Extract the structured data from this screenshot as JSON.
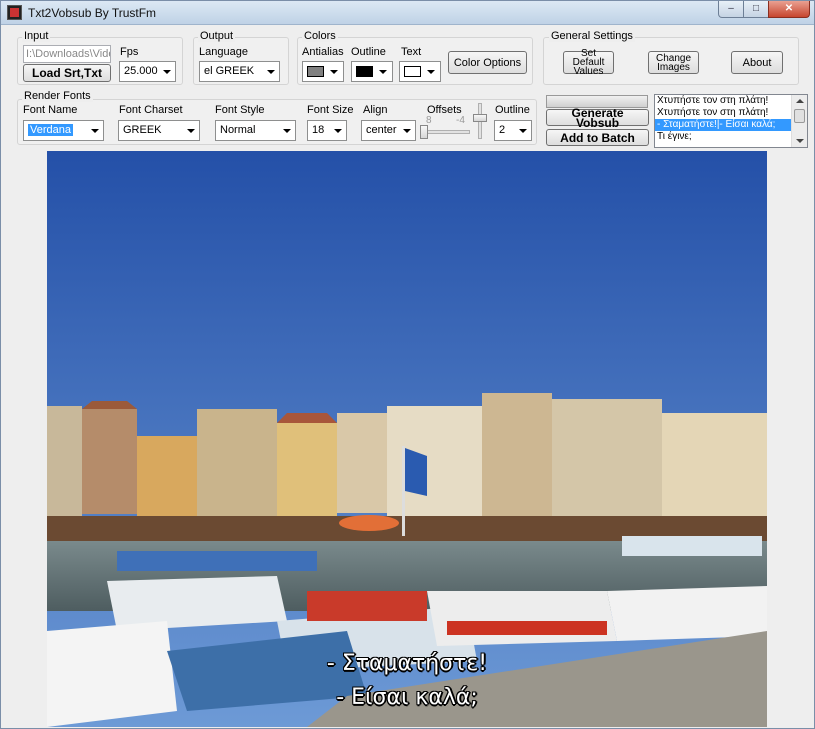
{
  "window": {
    "title": "Txt2Vobsub By TrustFm",
    "controls": {
      "minimize": "–",
      "maximize": "□",
      "close": "✕"
    }
  },
  "input": {
    "group_label": "Input",
    "path_value": "I:\\Downloads\\Video",
    "load_button": "Load Srt,Txt",
    "fps_label": "Fps",
    "fps_value": "25.000"
  },
  "output": {
    "group_label": "Output",
    "language_label": "Language",
    "language_value": "el GREEK"
  },
  "colors": {
    "group_label": "Colors",
    "antialias_label": "Antialias",
    "outline_label": "Outline",
    "text_label": "Text",
    "antialias_color": "#808080",
    "outline_color": "#000000",
    "text_color": "#ffffff",
    "options_button": "Color Options"
  },
  "general": {
    "group_label": "General Settings",
    "set_default_button": "Set Default Values",
    "change_images_button": "Change Images",
    "about_button": "About"
  },
  "render": {
    "group_label": "Render Fonts",
    "font_name_label": "Font Name",
    "font_name_value": "Verdana",
    "charset_label": "Font Charset",
    "charset_value": "GREEK",
    "style_label": "Font Style",
    "style_value": "Normal",
    "size_label": "Font Size",
    "size_value": "18",
    "align_label": "Align",
    "align_value": "center",
    "offsets_label": "Offsets",
    "offset_x": "8",
    "offset_y": "-4",
    "outline_label": "Outline",
    "outline_value": "2"
  },
  "actions": {
    "generate_button": "Generate Vobsub",
    "batch_button": "Add to Batch"
  },
  "subtitle_list": {
    "items": [
      "Χτυπήστε τον στη πλάτη!",
      "Χτυπήστε τον στη πλάτη!",
      "- Σταματήστε!|- Είσαι καλά;",
      "Τι έγινε;"
    ],
    "selected_index": 2
  },
  "preview": {
    "line1": "- Σταματήστε!",
    "line2": "- Είσαι καλά;"
  }
}
